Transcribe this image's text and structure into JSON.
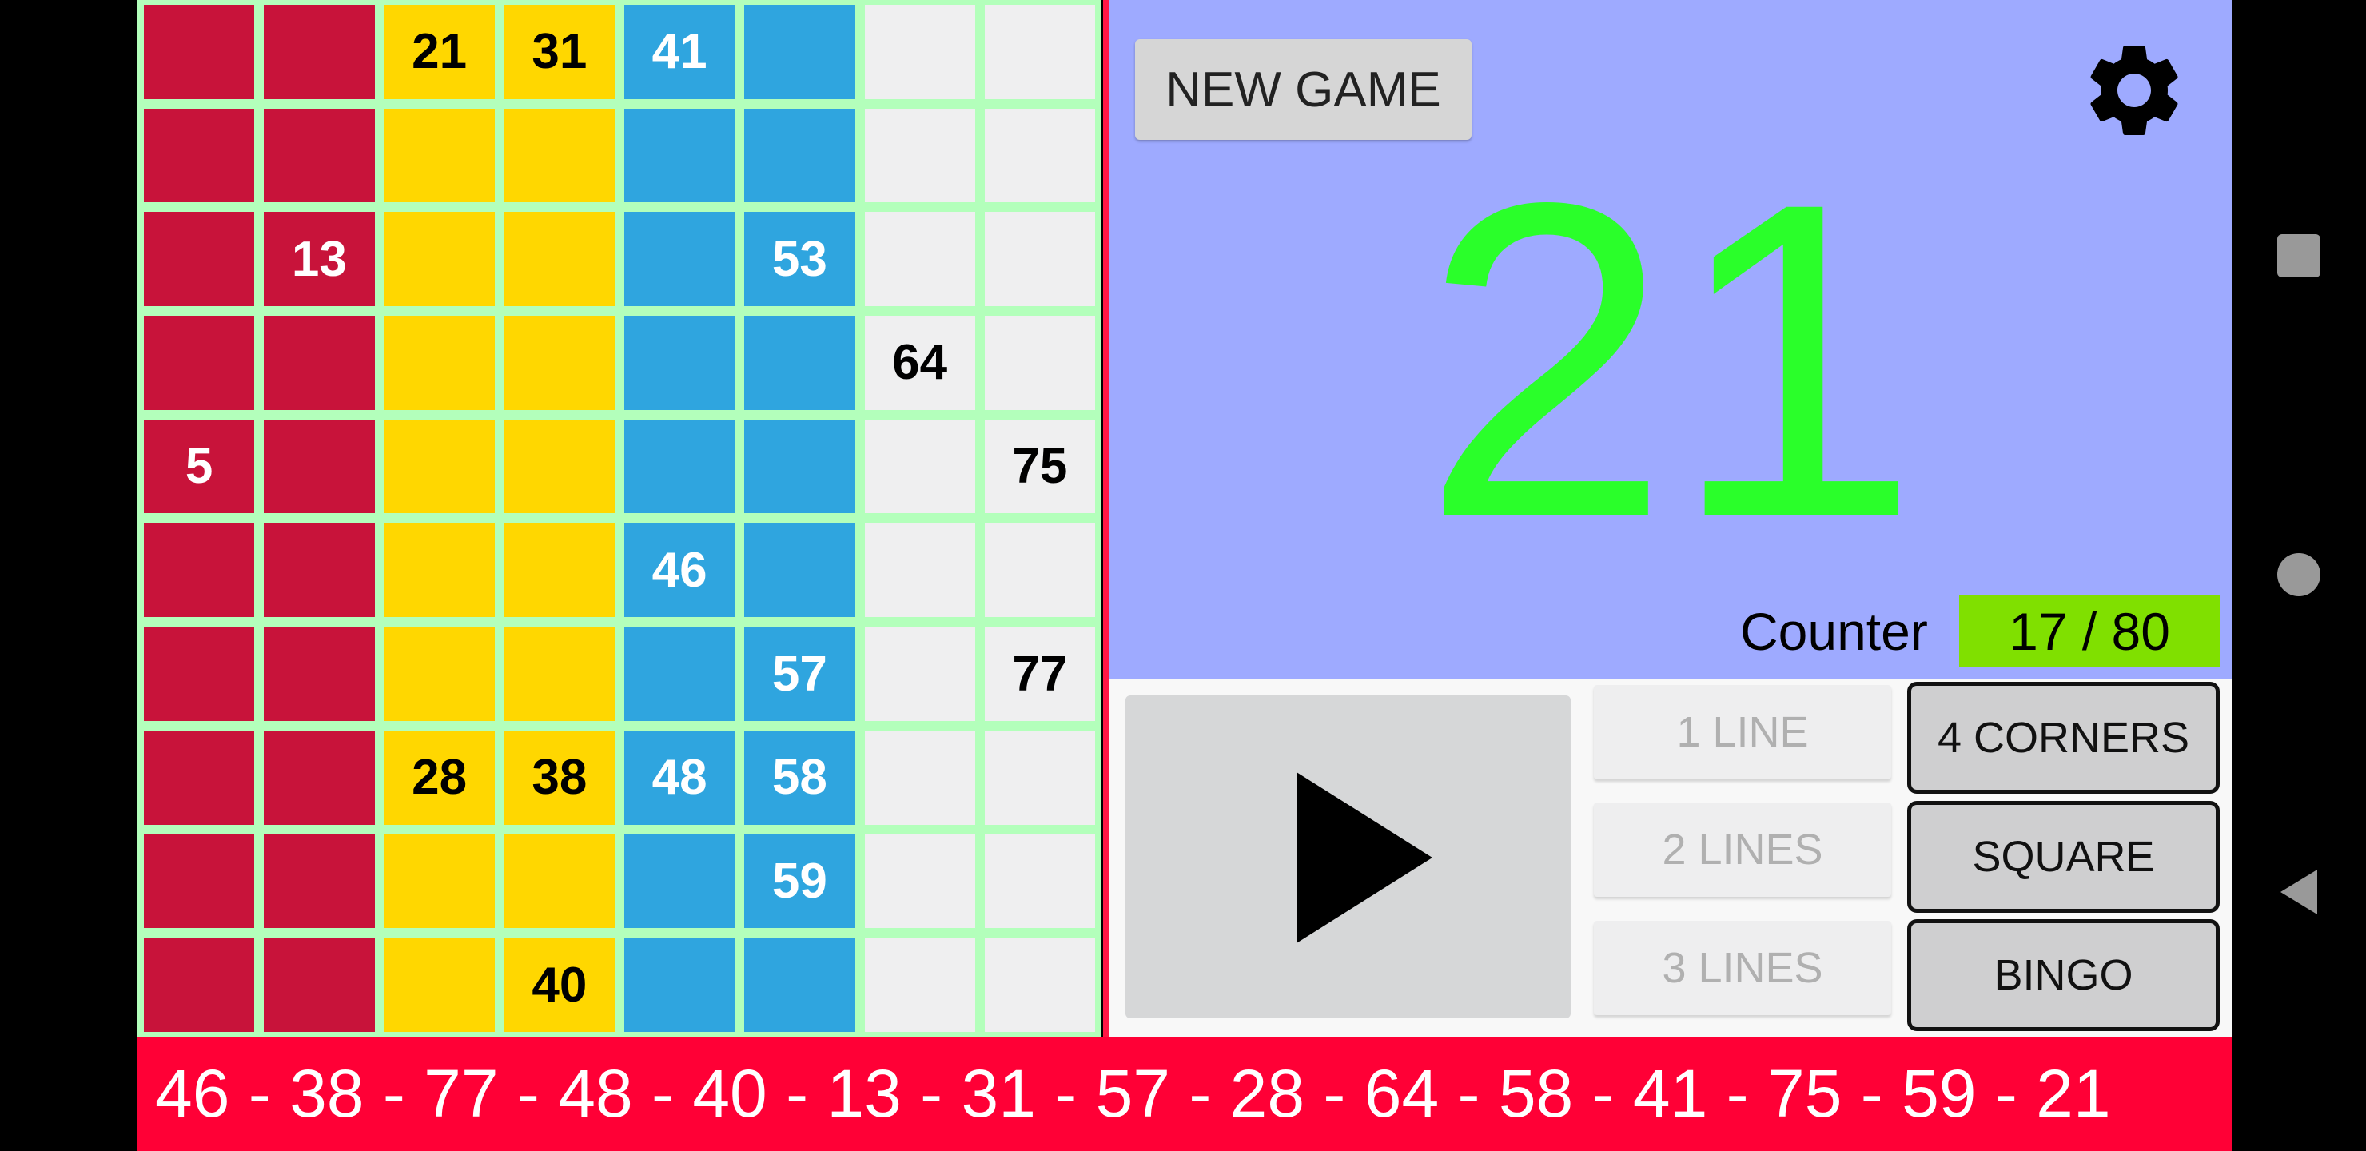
{
  "grid": {
    "column_colors": [
      "#c8133a",
      "#c8133a",
      "#ffd700",
      "#ffd700",
      "#2fa5df",
      "#2fa5df",
      "#efeff0",
      "#efeff0"
    ],
    "column_text_colors": [
      "#ffffff",
      "#ffffff",
      "#000000",
      "#000000",
      "#ffffff",
      "#ffffff",
      "#000000",
      "#000000"
    ],
    "rows": [
      [
        "",
        "",
        "21",
        "31",
        "41",
        "",
        "",
        ""
      ],
      [
        "",
        "",
        "",
        "",
        "",
        "",
        "",
        ""
      ],
      [
        "",
        "13",
        "",
        "",
        "",
        "53",
        "",
        ""
      ],
      [
        "",
        "",
        "",
        "",
        "",
        "",
        "64",
        ""
      ],
      [
        "5",
        "",
        "",
        "",
        "",
        "",
        "",
        "75"
      ],
      [
        "",
        "",
        "",
        "",
        "46",
        "",
        "",
        ""
      ],
      [
        "",
        "",
        "",
        "",
        "",
        "57",
        "",
        "77"
      ],
      [
        "",
        "",
        "28",
        "38",
        "48",
        "58",
        "",
        ""
      ],
      [
        "",
        "",
        "",
        "",
        "",
        "59",
        "",
        ""
      ],
      [
        "",
        "",
        "",
        "40",
        "",
        "",
        "",
        ""
      ]
    ]
  },
  "header": {
    "new_game_label": "NEW GAME",
    "settings_icon": "gear-icon"
  },
  "current_number": "21",
  "current_number_color": "#2aff2a",
  "counter": {
    "label": "Counter",
    "value": "17 / 80"
  },
  "controls": {
    "play_icon": "play-icon",
    "line_buttons": [
      "1 LINE",
      "2 LINES",
      "3 LINES"
    ],
    "prize_buttons": [
      "4 CORNERS",
      "SQUARE",
      "BINGO"
    ]
  },
  "history": "46 - 38 - 77 - 48 - 40 - 13 - 31 - 57 - 28 - 64 - 58 - 41 - 75 - 59 - 21"
}
